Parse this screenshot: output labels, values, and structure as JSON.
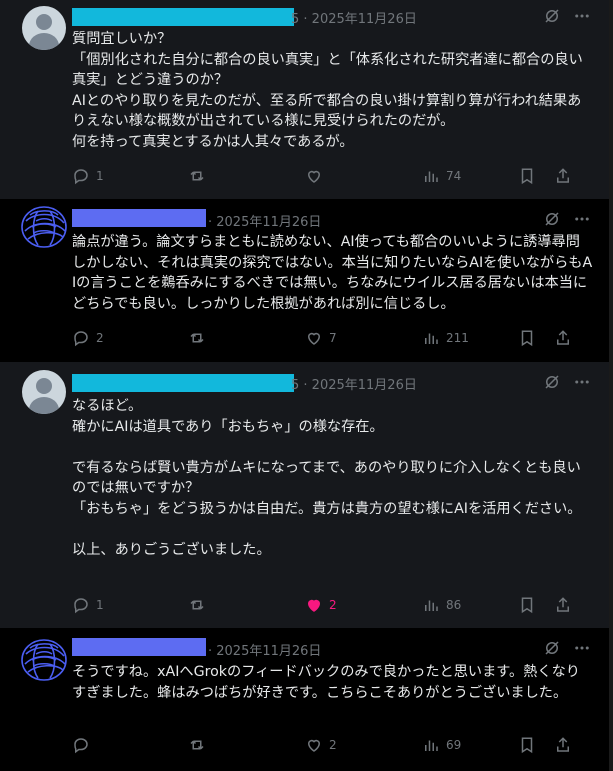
{
  "posts": [
    {
      "meta": "5 · 2025年11月26日",
      "text": "質問宜しいか？\n「個別化された自分に都合の良い真実」と「体系化された研究者達に都合の良い真実」とどう違うのか？\nAIとのやり取りを見たのだが、至る所で都合の良い掛け算割り算が行われ結果ありえない様な概数が出されている様に見受けられたのだが。\n何を持って真実とするかは人其々であるが。",
      "replies": "1",
      "reposts": "",
      "likes": "",
      "views": "74"
    },
    {
      "meta": "· 2025年11月26日",
      "text": "論点が違う。論文すらまともに読めない、AI使っても都合のいいように誘導尋問しかしない、それは真実の探究ではない。本当に知りたいならAIを使いながらもAIの言うことを鵜呑みにするべきでは無い。ちなみにウイルス居る居ないは本当にどちらでも良い。しっかりした根拠があれば別に信じるし。",
      "replies": "2",
      "reposts": "",
      "likes": "7",
      "views": "211"
    },
    {
      "meta": "5 · 2025年11月26日",
      "text": "なるほど。\n確かにAIは道具であり「おもちゃ」の様な存在。\n\nで有るならば賢い貴方がムキになってまで、あのやり取りに介入しなくとも良いのでは無いですか？\n「おもちゃ」をどう扱うかは自由だ。貴方は貴方の望む様にAIを活用ください。\n\n以上、ありごうございました。",
      "replies": "1",
      "reposts": "",
      "likes": "2",
      "views": "86"
    },
    {
      "meta": "· 2025年11月26日",
      "text": "そうですね。xAIへGrokのフィードバックのみで良かったと思います。熱くなりすぎました。蜂はみつばちが好きです。こちらこそありがとうございました。",
      "replies": "",
      "reposts": "",
      "likes": "2",
      "views": "69"
    }
  ]
}
